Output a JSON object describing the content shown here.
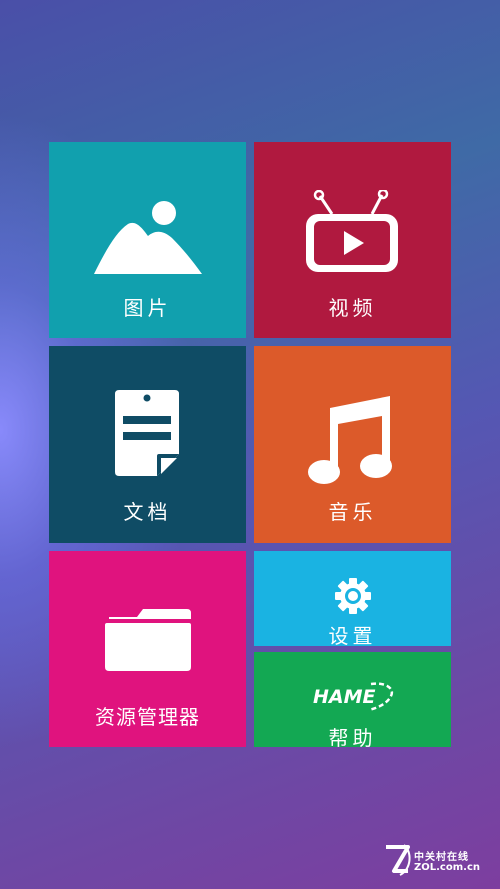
{
  "tiles": {
    "pictures": {
      "label": "图片",
      "color": "#11a0ae",
      "icon": "mountain-image-icon"
    },
    "video": {
      "label": "视频",
      "color": "#b0193f",
      "icon": "tv-play-icon"
    },
    "documents": {
      "label": "文档",
      "color": "#0f4c65",
      "icon": "document-icon"
    },
    "music": {
      "label": "音乐",
      "color": "#dc5a2a",
      "icon": "music-note-icon"
    },
    "files": {
      "label": "资源管理器",
      "color": "#e0137e",
      "icon": "folder-icon"
    },
    "settings": {
      "label": "设置",
      "color": "#1ab3e2",
      "icon": "gear-icon"
    },
    "help": {
      "label": "帮助",
      "color": "#13a853",
      "icon": "hame-logo-icon",
      "logo_text": "HAME"
    }
  },
  "watermark": {
    "top_text": "中关村在线",
    "bottom_text": "ZOL.com.cn"
  }
}
